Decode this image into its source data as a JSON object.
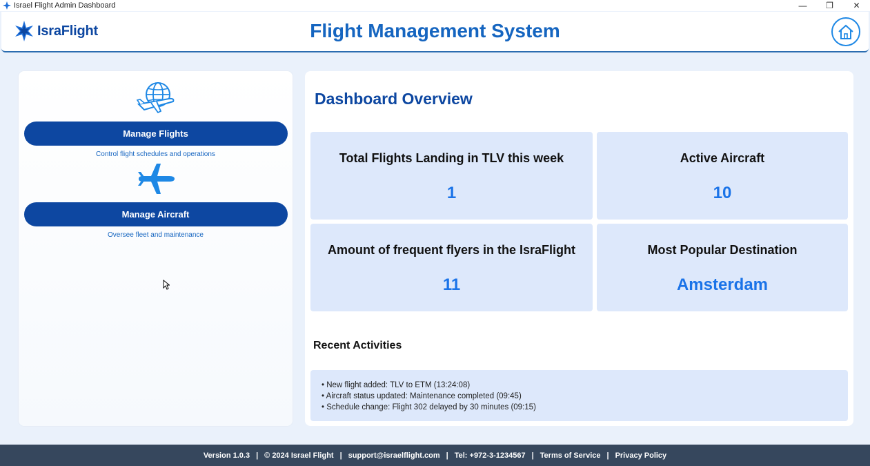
{
  "window": {
    "title": "Israel Flight Admin Dashboard",
    "minimize": "—",
    "restore": "❐",
    "close": "✕"
  },
  "header": {
    "logo_text": "IsraFlight",
    "title": "Flight Management System",
    "home_icon": "home-icon"
  },
  "sidebar": {
    "items": [
      {
        "icon": "globe-plane-icon",
        "label": "Manage Flights",
        "description": "Control flight schedules and operations"
      },
      {
        "icon": "airplane-icon",
        "label": "Manage Aircraft",
        "description": "Oversee fleet and maintenance"
      }
    ]
  },
  "dashboard": {
    "title": "Dashboard Overview",
    "stats": [
      {
        "label": "Total Flights Landing in TLV this week",
        "value": "1"
      },
      {
        "label": "Active Aircraft",
        "value": "10"
      },
      {
        "label": "Amount of frequent flyers in the IsraFlight",
        "value": "11"
      },
      {
        "label": "Most Popular Destination",
        "value": "Amsterdam"
      }
    ]
  },
  "recent": {
    "title": "Recent Activities",
    "items": [
      "• New flight added: TLV to ETM (13:24:08)",
      "• Aircraft status updated: Maintenance completed (09:45)",
      "• Schedule change: Flight 302 delayed by 30 minutes (09:15)"
    ]
  },
  "footer": {
    "version": "Version 1.0.3",
    "copyright": "© 2024 Israel Flight",
    "email": "support@israelflight.com",
    "phone": "Tel: +972-3-1234567",
    "terms": "Terms of Service",
    "privacy": "Privacy Policy",
    "separator": "|"
  },
  "colors": {
    "primary": "#0d47a1",
    "accent": "#1a73e8",
    "card": "#dde8fb",
    "footer": "#36475d"
  }
}
